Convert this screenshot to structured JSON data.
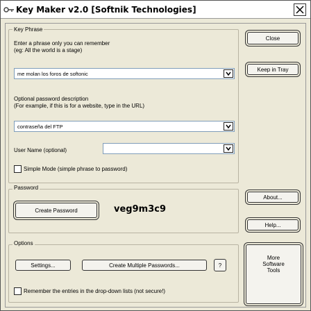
{
  "window": {
    "title": "Key Maker v2.0 [Softnik Technologies]"
  },
  "key_phrase": {
    "group_title": "Key Phrase",
    "intro_line1": "Enter a phrase only you can remember",
    "intro_line2": "(eg: All the world is a stage)",
    "phrase_value": "me molan los foros de softonic",
    "desc_line1": "Optional password description",
    "desc_line2": "(For example, if this is for a website, type in the URL)",
    "description_value": "contraseña del FTP",
    "username_label": "User Name (optional)",
    "username_value": "",
    "simple_mode_label": "Simple Mode (simple phrase to password)",
    "simple_mode_checked": false
  },
  "password": {
    "group_title": "Password",
    "create_button": "Create Password",
    "generated": "veg9m3c9"
  },
  "options": {
    "group_title": "Options",
    "settings_button": "Settings...",
    "multiple_button": "Create Multiple Passwords...",
    "help_q": "?",
    "remember_label": "Remember the entries in the drop-down lists (not secure!)",
    "remember_checked": false
  },
  "side": {
    "close_button": "Close",
    "keep_tray_button": "Keep in Tray",
    "about_button": "About...",
    "help_button": "Help...",
    "more_line1": "More",
    "more_line2": "Software",
    "more_line3": "Tools"
  }
}
